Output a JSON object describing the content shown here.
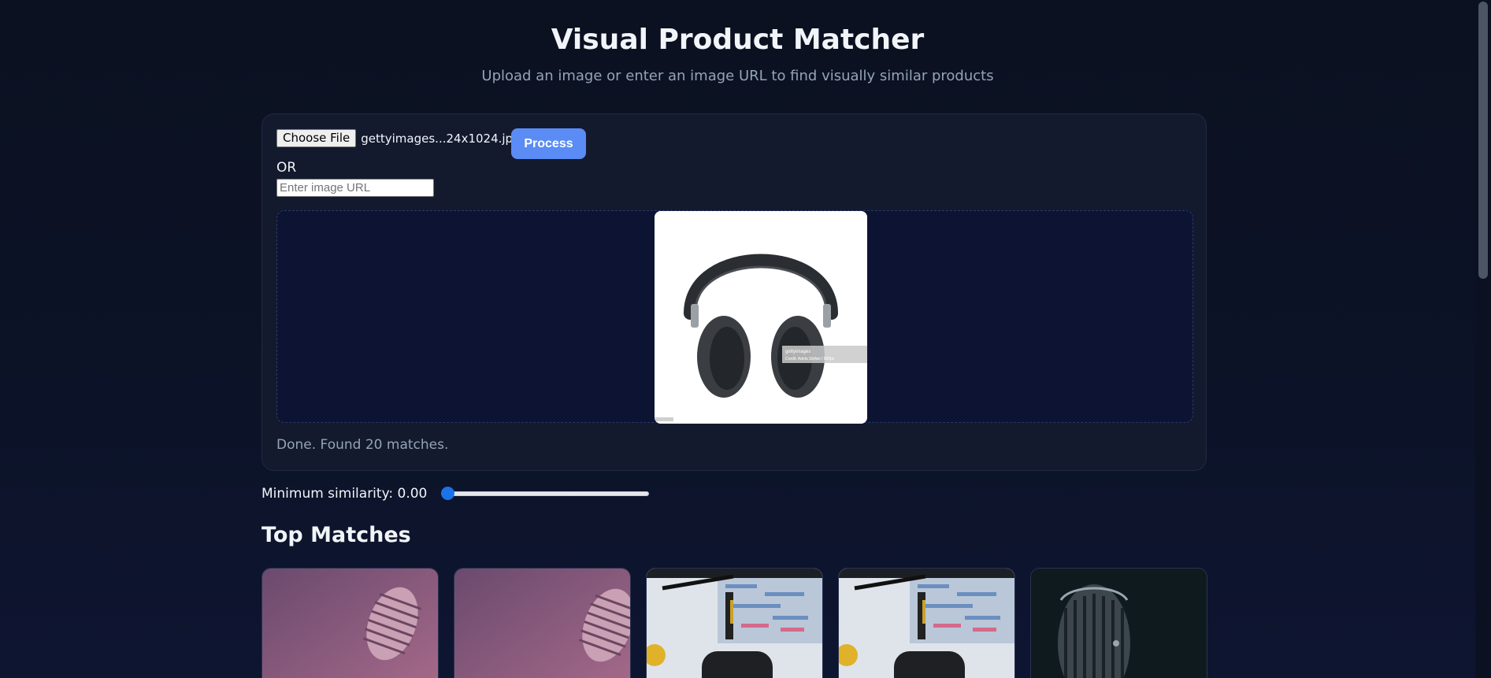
{
  "header": {
    "title": "Visual Product Matcher",
    "subtitle": "Upload an image or enter an image URL to find visually similar products"
  },
  "upload": {
    "choose_file_label": "Choose File",
    "file_name": "gettyimages...24x1024.jpg",
    "process_label": "Process",
    "or_label": "OR",
    "url_placeholder": "Enter image URL",
    "url_value": ""
  },
  "preview": {
    "watermark_brand": "gettyimages",
    "watermark_credit": "Credit: Adela Stefan / 500px"
  },
  "status": "Done. Found 20 matches.",
  "similarity": {
    "label": "Minimum similarity: 0.00",
    "value": 0.0,
    "min": 0,
    "max": 1
  },
  "results": {
    "heading": "Top Matches",
    "cards": [
      {
        "kind": "microphone-purple"
      },
      {
        "kind": "microphone-purple"
      },
      {
        "kind": "podcast-studio-mic"
      },
      {
        "kind": "podcast-studio-mic"
      },
      {
        "kind": "vintage-microphone-dark"
      }
    ]
  },
  "colors": {
    "accent": "#5b8cf5",
    "background": "#0b1120",
    "panel": "#131a2e",
    "muted_text": "#94a3b8",
    "slider": "#1a73e8"
  }
}
